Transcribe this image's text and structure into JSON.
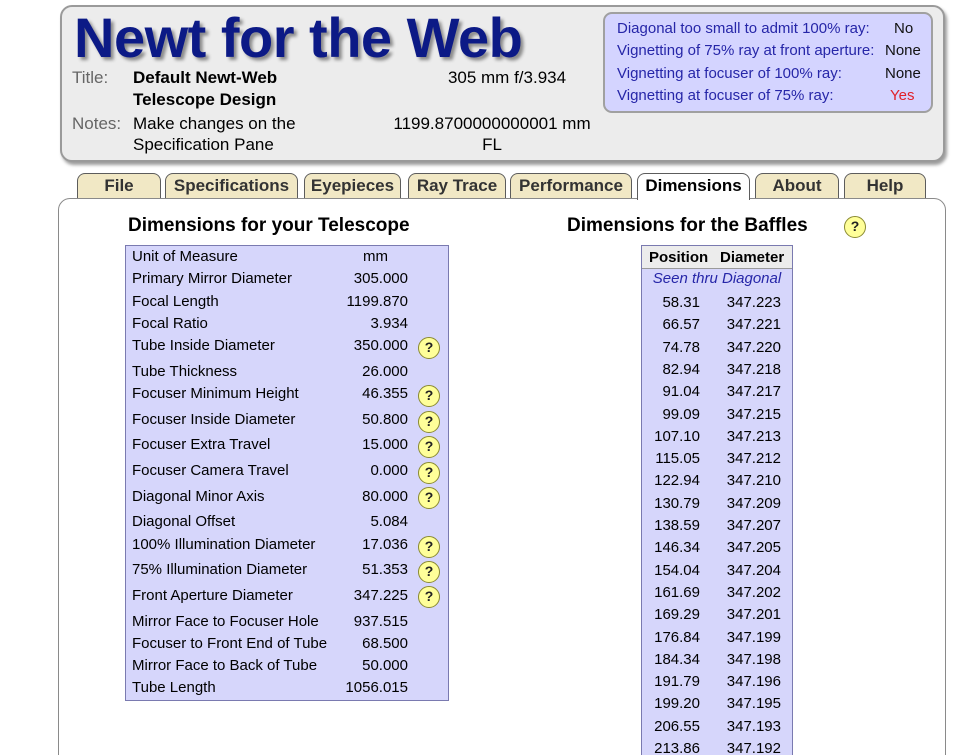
{
  "app": {
    "title": "Newt for the Web"
  },
  "header": {
    "title_label": "Title:",
    "title_line1": "Default Newt-Web",
    "title_line2": "Telescope Design",
    "notes_label": "Notes:",
    "notes_line1": "Make changes on the",
    "notes_line2": "Specification Pane",
    "aperture_ratio": "305 mm f/3.934",
    "focal_length_line1": "1199.8700000000001 mm",
    "focal_length_line2": "FL"
  },
  "warnings": [
    {
      "label": "Diagonal too small to admit 100% ray:",
      "value": "No",
      "status": "ok"
    },
    {
      "label": "Vignetting of 75% ray at front aperture:",
      "value": "None",
      "status": "ok"
    },
    {
      "label": "Vignetting at focuser of 100% ray:",
      "value": "None",
      "status": "ok"
    },
    {
      "label": "Vignetting at focuser of  75% ray:",
      "value": "Yes",
      "status": "bad"
    }
  ],
  "tabs": [
    {
      "label": "File",
      "active": false
    },
    {
      "label": "Specifications",
      "active": false
    },
    {
      "label": "Eyepieces",
      "active": false
    },
    {
      "label": "Ray Trace",
      "active": false
    },
    {
      "label": "Performance",
      "active": false
    },
    {
      "label": "Dimensions",
      "active": true
    },
    {
      "label": "About",
      "active": false
    },
    {
      "label": "Help",
      "active": false
    }
  ],
  "dimensions": {
    "title": "Dimensions for your Telescope",
    "rows": [
      {
        "label": "Unit of Measure",
        "value": "mm",
        "help": false
      },
      {
        "label": "Primary Mirror Diameter",
        "value": "305.000",
        "help": false
      },
      {
        "label": "Focal Length",
        "value": "1199.870",
        "help": false
      },
      {
        "label": "Focal Ratio",
        "value": "3.934",
        "help": false
      },
      {
        "label": "Tube Inside Diameter",
        "value": "350.000",
        "help": true
      },
      {
        "label": "Tube Thickness",
        "value": "26.000",
        "help": false
      },
      {
        "label": "Focuser Minimum Height",
        "value": "46.355",
        "help": true
      },
      {
        "label": "Focuser Inside Diameter",
        "value": "50.800",
        "help": true
      },
      {
        "label": "Focuser Extra Travel",
        "value": "15.000",
        "help": true
      },
      {
        "label": "Focuser Camera Travel",
        "value": "0.000",
        "help": true
      },
      {
        "label": "Diagonal Minor Axis",
        "value": "80.000",
        "help": true
      },
      {
        "label": "Diagonal Offset",
        "value": "5.084",
        "help": false
      },
      {
        "label": "100% Illumination Diameter",
        "value": "17.036",
        "help": true
      },
      {
        "label": "75% Illumination Diameter",
        "value": "51.353",
        "help": true
      },
      {
        "label": "Front Aperture Diameter",
        "value": "347.225",
        "help": true
      },
      {
        "label": "Mirror Face to Focuser Hole",
        "value": "937.515",
        "help": false
      },
      {
        "label": "Focuser to Front End of Tube",
        "value": "68.500",
        "help": false
      },
      {
        "label": "Mirror Face to Back of Tube",
        "value": "50.000",
        "help": false
      },
      {
        "label": "Tube Length",
        "value": "1056.015",
        "help": false
      }
    ]
  },
  "baffles": {
    "title": "Dimensions for the Baffles",
    "col_position": "Position",
    "col_diameter": "Diameter",
    "subheader": "Seen thru Diagonal",
    "rows": [
      {
        "position": "58.31",
        "diameter": "347.223"
      },
      {
        "position": "66.57",
        "diameter": "347.221"
      },
      {
        "position": "74.78",
        "diameter": "347.220"
      },
      {
        "position": "82.94",
        "diameter": "347.218"
      },
      {
        "position": "91.04",
        "diameter": "347.217"
      },
      {
        "position": "99.09",
        "diameter": "347.215"
      },
      {
        "position": "107.10",
        "diameter": "347.213"
      },
      {
        "position": "115.05",
        "diameter": "347.212"
      },
      {
        "position": "122.94",
        "diameter": "347.210"
      },
      {
        "position": "130.79",
        "diameter": "347.209"
      },
      {
        "position": "138.59",
        "diameter": "347.207"
      },
      {
        "position": "146.34",
        "diameter": "347.205"
      },
      {
        "position": "154.04",
        "diameter": "347.204"
      },
      {
        "position": "161.69",
        "diameter": "347.202"
      },
      {
        "position": "169.29",
        "diameter": "347.201"
      },
      {
        "position": "176.84",
        "diameter": "347.199"
      },
      {
        "position": "184.34",
        "diameter": "347.198"
      },
      {
        "position": "191.79",
        "diameter": "347.196"
      },
      {
        "position": "199.20",
        "diameter": "347.195"
      },
      {
        "position": "206.55",
        "diameter": "347.193"
      },
      {
        "position": "213.86",
        "diameter": "347.192"
      }
    ]
  },
  "icons": {
    "help": "help-question-icon",
    "help_glyph": "?"
  },
  "colors": {
    "title_blue": "#0c1a86",
    "warning_text": "#2626a8",
    "warning_bad": "#e0202a",
    "tab_bg": "#f1e8c5",
    "table_bg": "#d6d6fb",
    "help_bg": "#ffff99"
  }
}
